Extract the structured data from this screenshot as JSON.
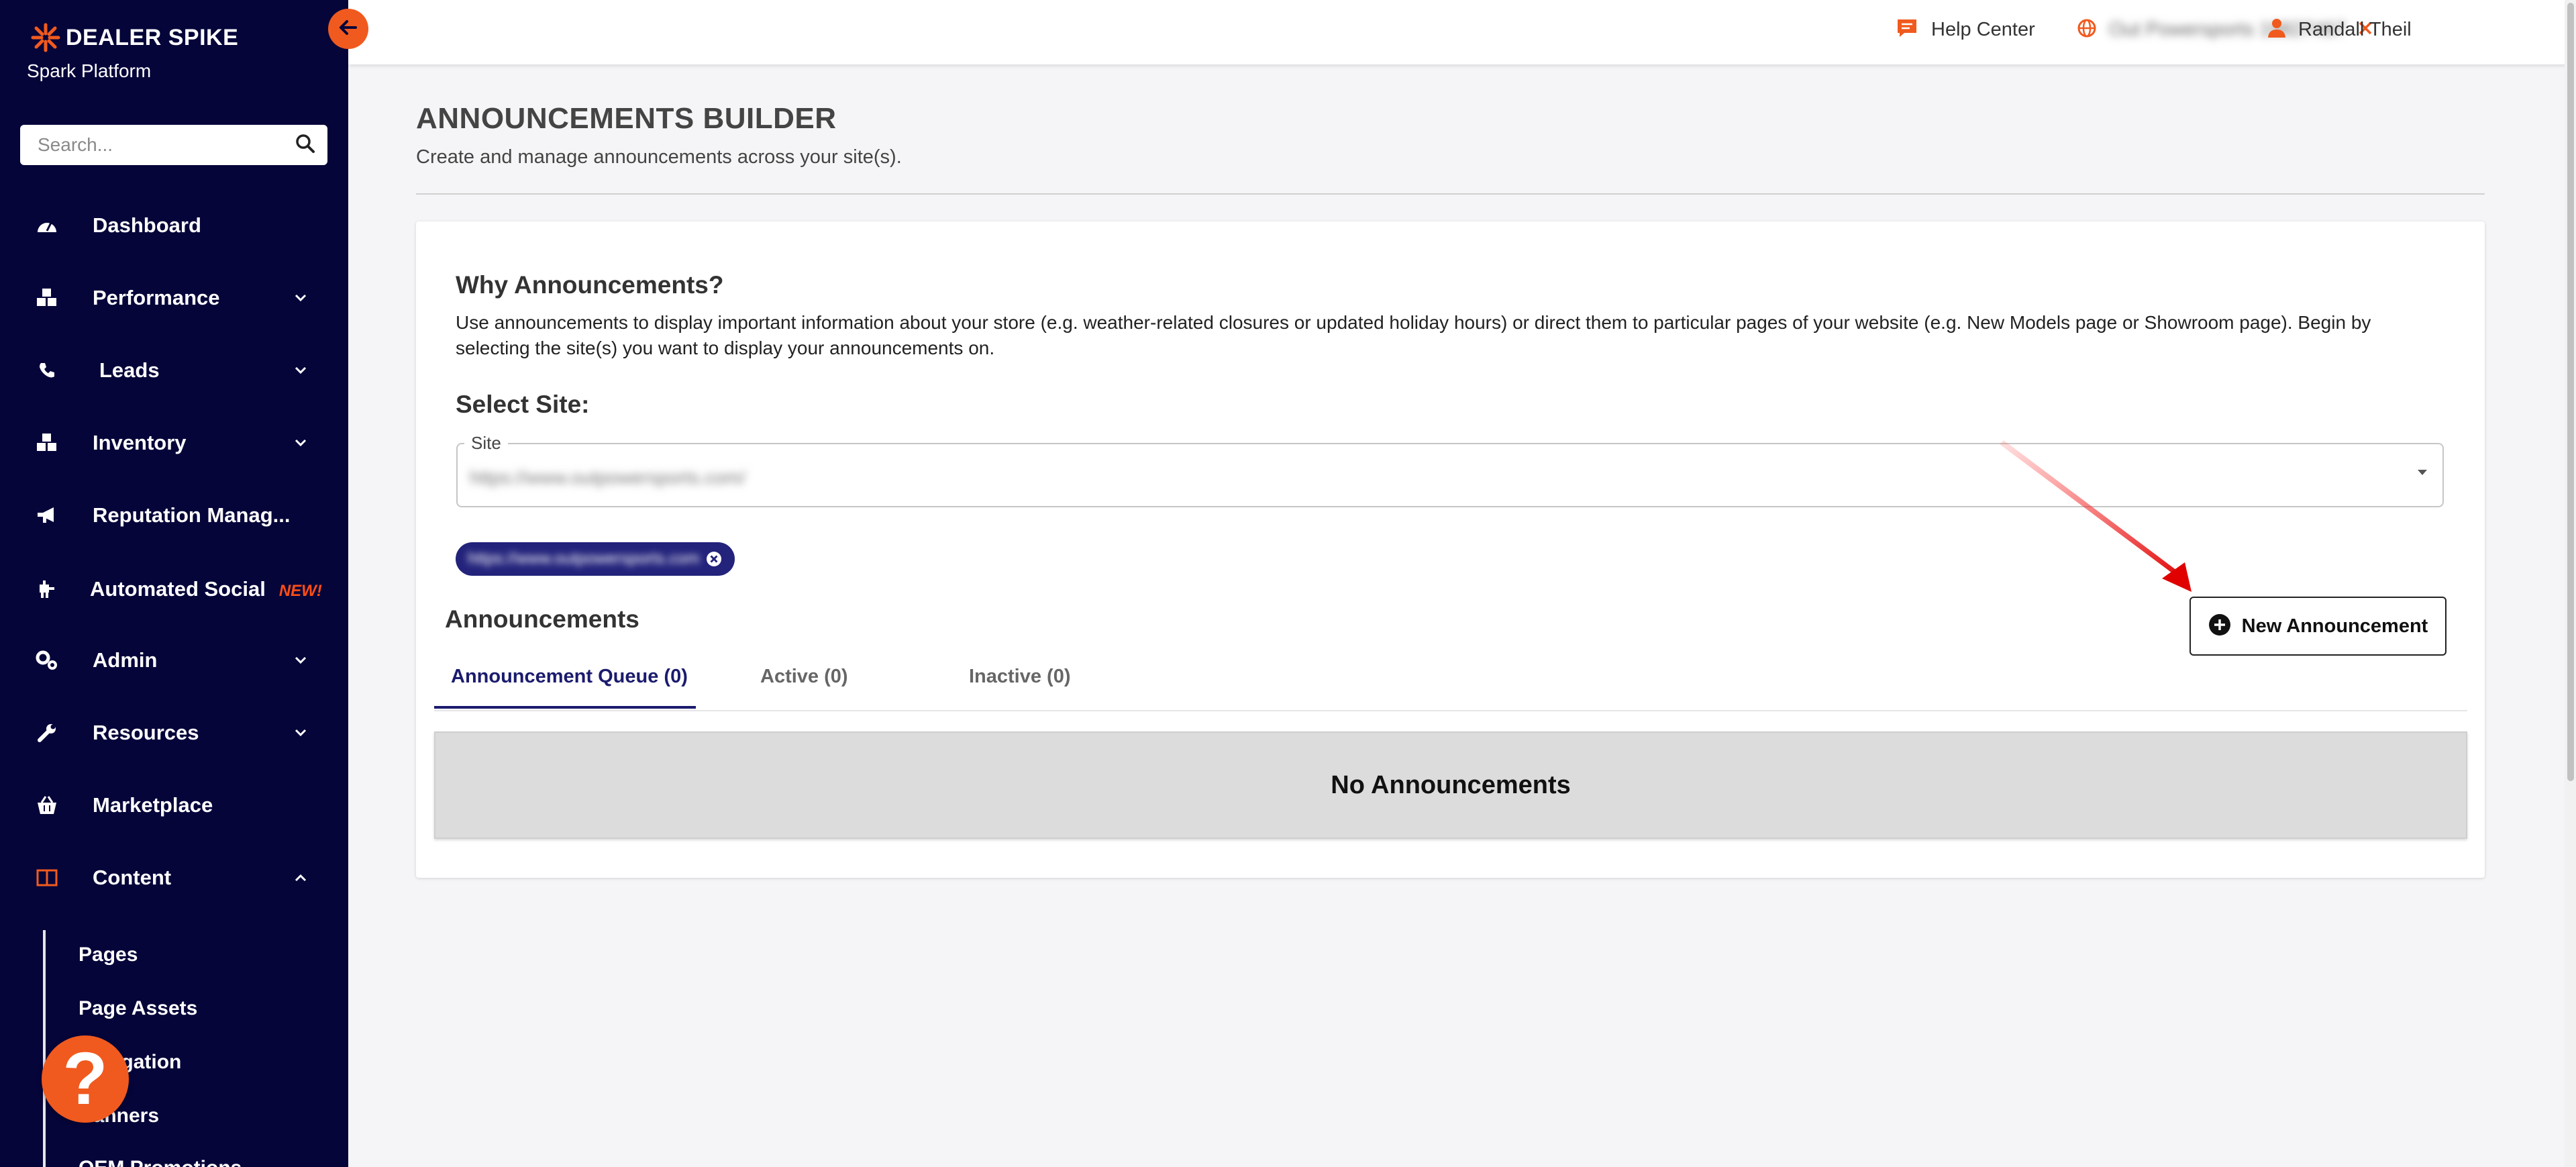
{
  "brand": {
    "name": "DEALER SPIKE",
    "subtitle": "Spark Platform",
    "accent": "#f05a1e",
    "sidebar_bg": "#06053a"
  },
  "search": {
    "placeholder": "Search..."
  },
  "nav": {
    "items": [
      {
        "label": "Dashboard",
        "icon": "gauge-icon",
        "chevron": false
      },
      {
        "label": "Performance",
        "icon": "cubes-icon",
        "chevron": true
      },
      {
        "label": "Leads",
        "icon": "phone-icon",
        "chevron": true
      },
      {
        "label": "Inventory",
        "icon": "cubes-icon",
        "chevron": true
      },
      {
        "label": "Reputation Manag...",
        "icon": "megaphone-icon",
        "chevron": false
      },
      {
        "label": "Automated Social",
        "icon": "robot-icon",
        "chevron": false,
        "badge": "NEW!"
      },
      {
        "label": "Admin",
        "icon": "gears-icon",
        "chevron": true
      },
      {
        "label": "Resources",
        "icon": "wrench-icon",
        "chevron": true
      },
      {
        "label": "Marketplace",
        "icon": "basket-icon",
        "chevron": false
      },
      {
        "label": "Content",
        "icon": "book-icon",
        "chevron": true,
        "expanded": true
      }
    ],
    "content_sub_items": [
      "Pages",
      "Page Assets",
      "Navigation",
      "Banners",
      "OEM Promotions"
    ]
  },
  "topbar": {
    "help_label": "Help Center",
    "site_label": "Out Powersports 19827467",
    "user_name": "Randall Theil"
  },
  "page": {
    "title": "ANNOUNCEMENTS BUILDER",
    "subtitle": "Create and manage announcements across your site(s)."
  },
  "why": {
    "title": "Why Announcements?",
    "text": "Use announcements to display important information about your store (e.g. weather-related closures or updated holiday hours) or direct them to particular pages of your website (e.g. New Models page or Showroom page). Begin by selecting the site(s) you want to display your announcements on."
  },
  "select_site": {
    "title": "Select Site:",
    "field_label": "Site",
    "field_value": "https://www.outpowersports.com/",
    "chip_label": "https://www.outpowersports.com"
  },
  "announcements": {
    "title": "Announcements",
    "new_button_label": "New Announcement",
    "tabs": [
      {
        "label": "Announcement Queue (0)",
        "active": true
      },
      {
        "label": "Active (0)",
        "active": false
      },
      {
        "label": "Inactive (0)",
        "active": false
      }
    ],
    "empty_text": "No Announcements"
  }
}
